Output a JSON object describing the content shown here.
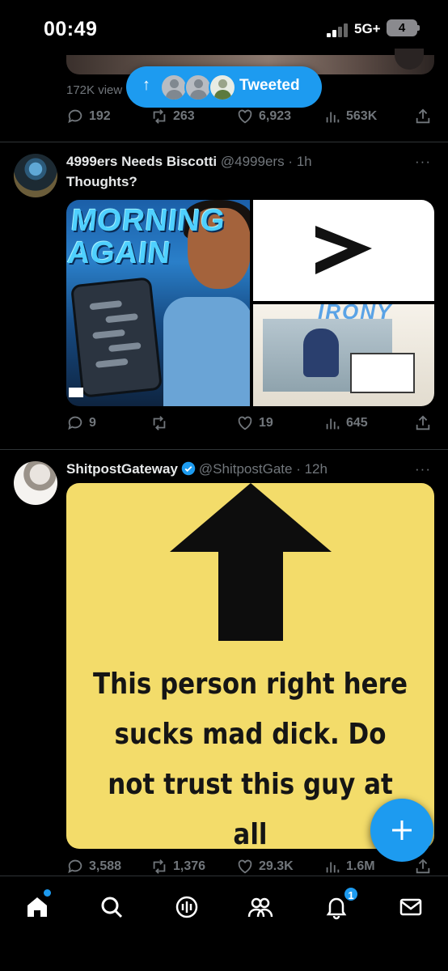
{
  "status_bar": {
    "time": "00:49",
    "network": "5G+",
    "battery": "4"
  },
  "top_post": {
    "views_partial": "172K view",
    "stats": {
      "replies": "192",
      "reposts": "263",
      "likes": "6,923",
      "views": "563K"
    }
  },
  "tweeted_pill": {
    "label": "Tweeted"
  },
  "posts": [
    {
      "display_name": "4999ers Needs Biscotti",
      "handle": "@4999ers",
      "time": "· 1h",
      "text": "Thoughts?",
      "media": {
        "left_title": "MORNING AGAIN",
        "bottom_right_title": "IRONY"
      },
      "stats": {
        "replies": "9",
        "reposts": "",
        "likes": "19",
        "views": "645"
      }
    },
    {
      "display_name": "ShitpostGateway",
      "verified": true,
      "handle": "@ShitpostGate",
      "time": "· 12h",
      "meme_text": "This person right here sucks mad dick. Do not trust this guy at all",
      "stats": {
        "replies": "3,588",
        "reposts": "1,376",
        "likes": "29.3K",
        "views": "1.6M"
      }
    }
  ],
  "more_icon": "···",
  "colors": {
    "accent": "#1d9bf0",
    "background": "#000000",
    "muted": "#71767b",
    "text": "#e7e9ea",
    "meme_bg": "#f3dc6a"
  },
  "tab_bar": {
    "items": [
      "home-icon",
      "search-icon",
      "spaces-icon",
      "communities-icon",
      "notifications-icon",
      "messages-icon"
    ],
    "notification_badge": "1"
  }
}
